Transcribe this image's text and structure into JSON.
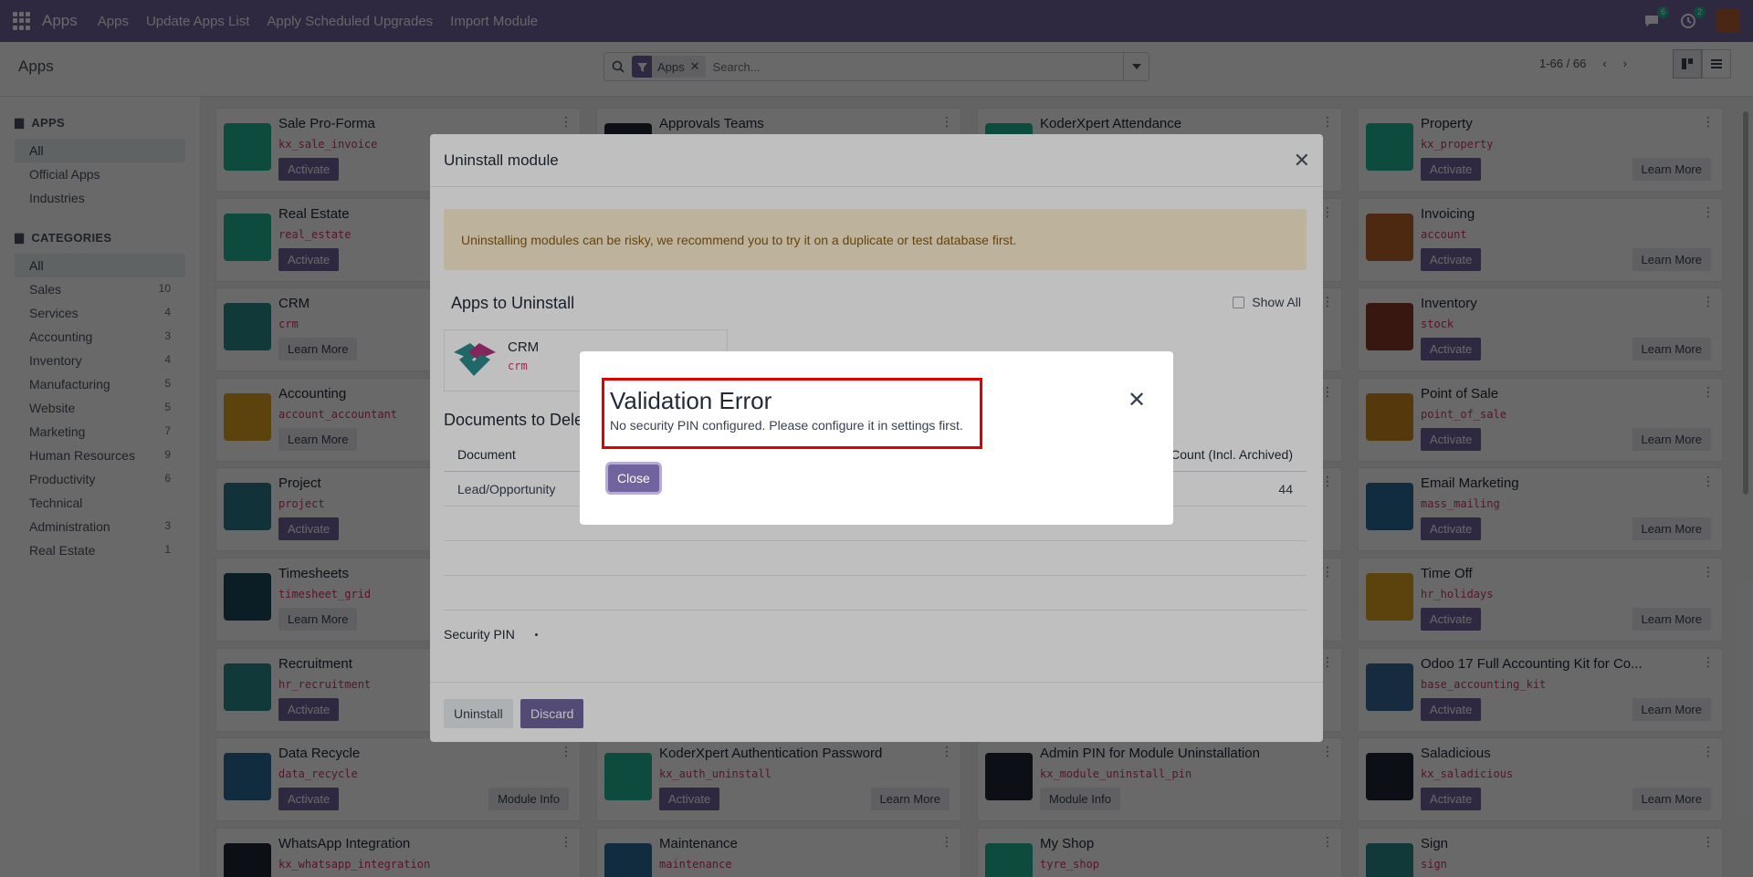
{
  "navbar": {
    "brand": "Apps",
    "menu": [
      "Apps",
      "Update Apps List",
      "Apply Scheduled Upgrades",
      "Import Module"
    ],
    "chat_count": "6",
    "activity_count": "2"
  },
  "control": {
    "breadcrumb": "Apps",
    "facet_label": "Apps",
    "search_placeholder": "Search...",
    "pager": "1-66 / 66"
  },
  "sidebar": {
    "apps_header": "APPS",
    "apps_items": [
      {
        "label": "All",
        "count": ""
      },
      {
        "label": "Official Apps",
        "count": ""
      },
      {
        "label": "Industries",
        "count": ""
      }
    ],
    "categories_header": "CATEGORIES",
    "categories": [
      {
        "label": "All",
        "count": ""
      },
      {
        "label": "Sales",
        "count": "10"
      },
      {
        "label": "Services",
        "count": "4"
      },
      {
        "label": "Accounting",
        "count": "3"
      },
      {
        "label": "Inventory",
        "count": "4"
      },
      {
        "label": "Manufacturing",
        "count": "5"
      },
      {
        "label": "Website",
        "count": "5"
      },
      {
        "label": "Marketing",
        "count": "7"
      },
      {
        "label": "Human Resources",
        "count": "9"
      },
      {
        "label": "Productivity",
        "count": "6"
      },
      {
        "label": "Technical",
        "count": ""
      },
      {
        "label": "Administration",
        "count": "3"
      },
      {
        "label": "Real Estate",
        "count": "1"
      }
    ]
  },
  "cards": [
    {
      "title": "Sale Pro-Forma",
      "tech": "kx_sale_invoice",
      "btn": "Activate",
      "right": "",
      "color": "#21b799"
    },
    {
      "title": "Approvals Teams",
      "tech": "",
      "btn": "",
      "right": "",
      "color": "#1f2937"
    },
    {
      "title": "KoderXpert Attendance",
      "tech": "",
      "btn": "",
      "right": "",
      "color": "#21b799"
    },
    {
      "title": "Property",
      "tech": "kx_property",
      "btn": "Activate",
      "right": "Learn More",
      "color": "#21b799"
    },
    {
      "title": "Real Estate",
      "tech": "real_estate",
      "btn": "Activate",
      "right": "",
      "color": "#21b799"
    },
    {
      "title": "",
      "tech": "",
      "btn": "",
      "right": "",
      "color": "#fff"
    },
    {
      "title": "",
      "tech": "",
      "btn": "",
      "right": "",
      "color": "#fff"
    },
    {
      "title": "Invoicing",
      "tech": "account",
      "btn": "Activate",
      "right": "Learn More",
      "color": "#c0652c"
    },
    {
      "title": "CRM",
      "tech": "crm",
      "btn": "Learn More",
      "right": "",
      "color": "#2a8a8c"
    },
    {
      "title": "",
      "tech": "",
      "btn": "",
      "right": "",
      "color": "#fff"
    },
    {
      "title": "",
      "tech": "",
      "btn": "",
      "right": "",
      "color": "#fff"
    },
    {
      "title": "Inventory",
      "tech": "stock",
      "btn": "Activate",
      "right": "Learn More",
      "color": "#8a3a2a"
    },
    {
      "title": "Accounting",
      "tech": "account_accountant",
      "btn": "Learn More",
      "right": "",
      "color": "#e0a020"
    },
    {
      "title": "",
      "tech": "",
      "btn": "",
      "right": "",
      "color": "#fff"
    },
    {
      "title": "",
      "tech": "",
      "btn": "",
      "right": "",
      "color": "#fff"
    },
    {
      "title": "Point of Sale",
      "tech": "point_of_sale",
      "btn": "Activate",
      "right": "Learn More",
      "color": "#d08a20"
    },
    {
      "title": "Project",
      "tech": "project",
      "btn": "Activate",
      "right": "",
      "color": "#2a7a8c"
    },
    {
      "title": "",
      "tech": "",
      "btn": "",
      "right": "",
      "color": "#fff"
    },
    {
      "title": "",
      "tech": "",
      "btn": "",
      "right": "",
      "color": "#fff"
    },
    {
      "title": "Email Marketing",
      "tech": "mass_mailing",
      "btn": "Activate",
      "right": "Learn More",
      "color": "#2a6a9c"
    },
    {
      "title": "Timesheets",
      "tech": "timesheet_grid",
      "btn": "Learn More",
      "right": "",
      "color": "#1f4a5c"
    },
    {
      "title": "",
      "tech": "",
      "btn": "",
      "right": "",
      "color": "#fff"
    },
    {
      "title": "",
      "tech": "",
      "btn": "",
      "right": "",
      "color": "#fff"
    },
    {
      "title": "Time Off",
      "tech": "hr_holidays",
      "btn": "Activate",
      "right": "Learn More",
      "color": "#e0a020"
    },
    {
      "title": "Recruitment",
      "tech": "hr_recruitment",
      "btn": "Activate",
      "right": "",
      "color": "#2a8a8c"
    },
    {
      "title": "",
      "tech": "",
      "btn": "",
      "right": "",
      "color": "#fff"
    },
    {
      "title": "",
      "tech": "",
      "btn": "",
      "right": "",
      "color": "#fff"
    },
    {
      "title": "Odoo 17 Full Accounting Kit for Co...",
      "tech": "base_accounting_kit",
      "btn": "Activate",
      "right": "Learn More",
      "color": "#3a6a9c"
    },
    {
      "title": "Data Recycle",
      "tech": "data_recycle",
      "btn": "Activate",
      "right": "Module Info",
      "color": "#2a6a9c"
    },
    {
      "title": "KoderXpert Authentication Password",
      "tech": "kx_auth_uninstall",
      "btn": "Activate",
      "right": "Learn More",
      "color": "#21b799"
    },
    {
      "title": "Admin PIN for Module Uninstallation",
      "tech": "kx_module_uninstall_pin",
      "btn": "Module Info",
      "right": "",
      "color": "#1f2937"
    },
    {
      "title": "Saladicious",
      "tech": "kx_saladicious",
      "btn": "Activate",
      "right": "Learn More",
      "color": "#1f2937"
    },
    {
      "title": "WhatsApp Integration",
      "tech": "kx_whatsapp_integration",
      "btn": "",
      "right": "",
      "color": "#1f2937"
    },
    {
      "title": "Maintenance",
      "tech": "maintenance",
      "btn": "",
      "right": "",
      "color": "#2a6a9c"
    },
    {
      "title": "My Shop",
      "tech": "tyre_shop",
      "btn": "",
      "right": "",
      "color": "#21b799"
    },
    {
      "title": "Sign",
      "tech": "sign",
      "btn": "",
      "right": "",
      "color": "#2a8a8c"
    }
  ],
  "modal": {
    "title": "Uninstall module",
    "warning": "Uninstalling modules can be risky, we recommend you to try it on a duplicate or test database first.",
    "apps_title": "Apps to Uninstall",
    "show_all": "Show All",
    "app_name": "CRM",
    "app_tech": "crm",
    "docs_title": "Documents to Delete",
    "col_document": "Document",
    "col_count": "Count (Incl. Archived)",
    "row_doc": "Lead/Opportunity",
    "row_count": "44",
    "pin_label": "Security PIN",
    "uninstall_btn": "Uninstall",
    "discard_btn": "Discard"
  },
  "dialog": {
    "title": "Validation Error",
    "message": "No security PIN configured. Please configure it in settings first.",
    "close_btn": "Close"
  }
}
